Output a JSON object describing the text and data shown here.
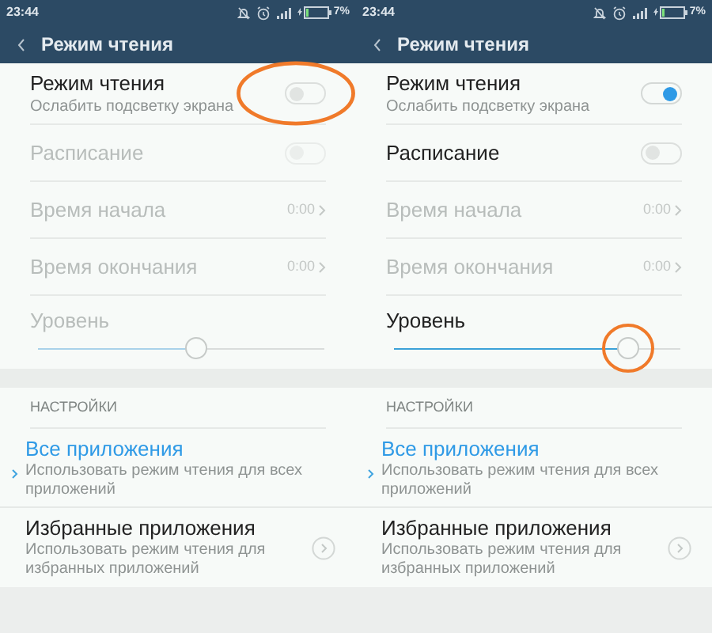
{
  "screens": [
    {
      "status_bar": {
        "time": "23:44",
        "battery": "7%"
      },
      "title": "Режим чтения",
      "rows": [
        {
          "kind": "toggle",
          "title": "Режим чтения",
          "subtitle": "Ослабить подсветку экрана",
          "on": false,
          "disabled": false,
          "circled": true
        },
        {
          "kind": "toggle",
          "title": "Расписание",
          "on": false,
          "disabled": true,
          "circled": false
        },
        {
          "kind": "time",
          "title": "Время начала",
          "value": "0:00",
          "disabled": true
        },
        {
          "kind": "time",
          "title": "Время окончания",
          "value": "0:00",
          "disabled": true
        },
        {
          "kind": "slider",
          "title": "Уровень",
          "level": 0.55,
          "disabled": true,
          "circled": false
        }
      ],
      "section": "НАСТРОЙКИ",
      "options": [
        {
          "title": "Все приложения",
          "subtitle": "Использовать режим чтения для всех приложений",
          "selected": true
        },
        {
          "title": "Избранные приложения",
          "subtitle": "Использовать режим чтения для избранных приложений",
          "selected": false
        }
      ]
    },
    {
      "status_bar": {
        "time": "23:44",
        "battery": "7%"
      },
      "title": "Режим чтения",
      "rows": [
        {
          "kind": "toggle",
          "title": "Режим чтения",
          "subtitle": "Ослабить подсветку экрана",
          "on": true,
          "disabled": false,
          "circled": false
        },
        {
          "kind": "toggle",
          "title": "Расписание",
          "on": false,
          "disabled": false,
          "circled": false
        },
        {
          "kind": "time",
          "title": "Время начала",
          "value": "0:00",
          "disabled": true
        },
        {
          "kind": "time",
          "title": "Время окончания",
          "value": "0:00",
          "disabled": true
        },
        {
          "kind": "slider",
          "title": "Уровень",
          "level": 0.82,
          "disabled": false,
          "circled": true
        }
      ],
      "section": "НАСТРОЙКИ",
      "options": [
        {
          "title": "Все приложения",
          "subtitle": "Использовать режим чтения для всех приложений",
          "selected": true
        },
        {
          "title": "Избранные приложения",
          "subtitle": "Использовать режим чтения для избранных приложений",
          "selected": false
        }
      ]
    }
  ]
}
